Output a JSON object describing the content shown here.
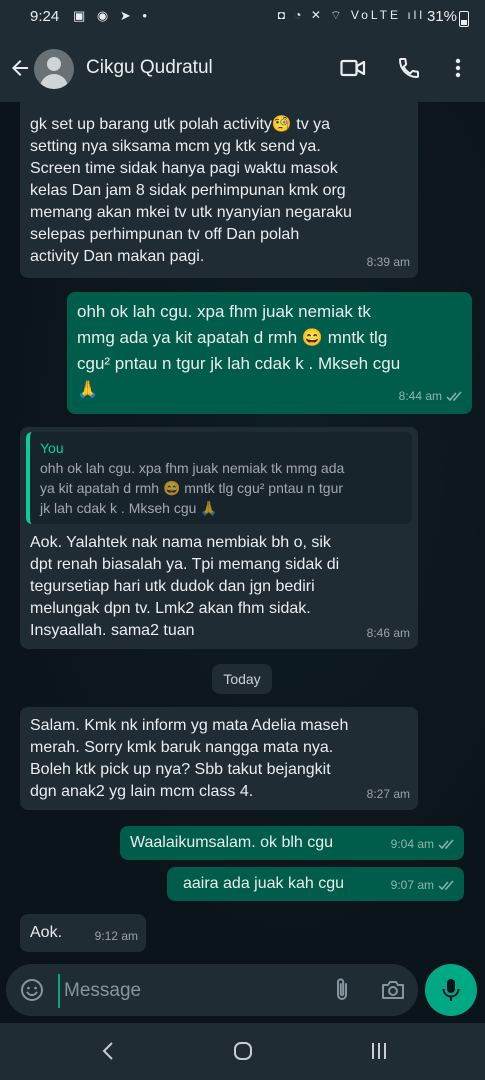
{
  "status_bar": {
    "time": "9:24",
    "left_icons": "▣ ◉ ➤ •",
    "right_icons": "◘ ◔ ✕ ⌔ VoLTE ıll",
    "battery": "31%"
  },
  "header": {
    "contact_name": "Cikgu Qudratul"
  },
  "messages": [
    {
      "text": "gk set up barang utk polah activity🧐 tv ya\nsetting nya siksama mcm yg ktk send ya.\nScreen time sidak hanya pagi waktu masok\nkelas Dan jam 8 sidak perhimpunan kmk org\nmemang akan mkei tv utk nyanyian negaraku\nselepas perhimpunan tv off Dan polah\nactivity Dan makan pagi.",
      "time": "8:39 am"
    },
    {
      "text": "ohh ok lah cgu. xpa fhm juak nemiak tk\nmmg ada ya kit apatah d rmh 😄 mntk tlg\ncgu² pntau n tgur jk lah cdak k . Mkseh cgu\n🙏",
      "time": "8:44 am"
    },
    {
      "quote_author": "You",
      "quote_text": "ohh ok lah cgu. xpa fhm juak nemiak tk mmg ada\nya kit apatah d rmh 😄 mntk tlg cgu² pntau n tgur\njk lah cdak k . Mkseh cgu 🙏",
      "text": "Aok. Yalahtek nak nama nembiak bh o, sik\ndpt renah biasalah ya. Tpi memang sidak di\ntegursetiap hari utk dudok dan jgn bediri\nmelungak dpn tv. Lmk2 akan fhm sidak.\nInsyaallah. sama2 tuan",
      "time": "8:46 am"
    },
    {
      "text": "Salam. Kmk nk inform yg mata Adelia maseh\nmerah. Sorry kmk baruk nangga mata nya.\nBoleh ktk  pick up nya? Sbb takut bejangkit\ndgn anak2 yg lain mcm class 4.",
      "time": "8:27 am"
    },
    {
      "text": "Waalaikumsalam. ok blh cgu",
      "time": "9:04 am"
    },
    {
      "text": "aaira ada juak kah cgu",
      "time": "9:07 am"
    },
    {
      "text": "Aok.",
      "time": "9:12 am"
    }
  ],
  "date_divider": "Today",
  "composer": {
    "placeholder": "Message"
  },
  "colors": {
    "background": "#0b141a",
    "incoming_bubble": "#1f2c33",
    "outgoing_bubble": "#005c4b",
    "accent": "#00a884"
  },
  "icons": [
    "back-arrow-icon",
    "avatar-icon",
    "video-call-icon",
    "phone-icon",
    "more-vertical-icon",
    "double-check-icon",
    "emoji-icon",
    "attach-icon",
    "camera-icon",
    "mic-icon",
    "nav-back-icon",
    "nav-home-icon",
    "nav-recents-icon"
  ]
}
